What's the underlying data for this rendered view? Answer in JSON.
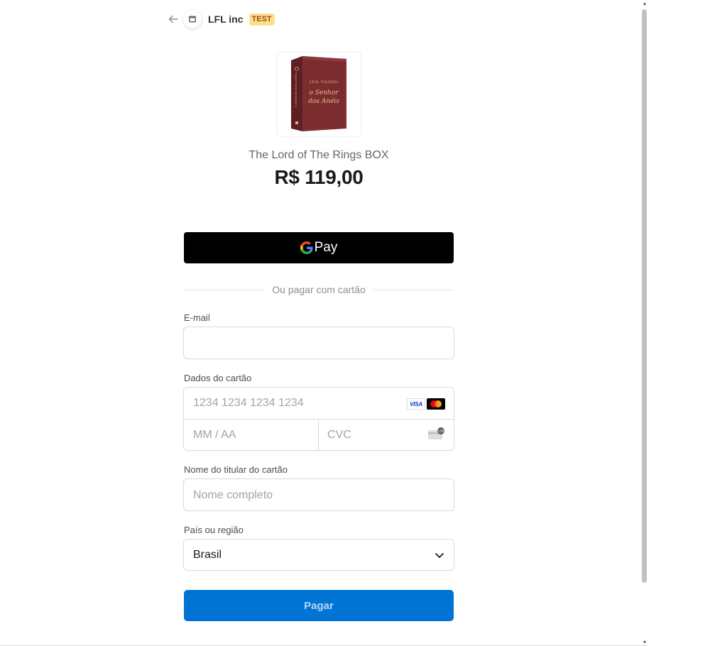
{
  "header": {
    "back_icon": "arrow-left-icon",
    "store_icon": "store-icon",
    "merchant_name": "LFL inc",
    "test_badge": "TEST"
  },
  "product": {
    "image_icon": "book-box-image",
    "name": "The Lord of The Rings BOX",
    "price": "R$ 119,00",
    "image_color": "#7a2a2e"
  },
  "gpay": {
    "label": "Pay",
    "icon": "google-g-icon"
  },
  "divider": {
    "text": "Ou pagar com cartão"
  },
  "email": {
    "label": "E-mail",
    "value": "",
    "placeholder": ""
  },
  "card": {
    "label": "Dados do cartão",
    "number_placeholder": "1234 1234 1234 1234",
    "expiry_placeholder": "MM / AA",
    "cvc_placeholder": "CVC",
    "visa_text": "VISA",
    "brands": [
      "visa-icon",
      "mastercard-icon"
    ],
    "cvc_icon": "card-cvc-icon"
  },
  "cardholder": {
    "label": "Nome do titular do cartão",
    "placeholder": "Nome completo"
  },
  "country": {
    "label": "País ou região",
    "selected": "Brasil",
    "icon": "chevron-down-icon"
  },
  "pay_button": {
    "label": "Pagar",
    "color": "#0074d4"
  },
  "colors": {
    "accent": "#0074d4",
    "test_badge_bg": "#ffde92",
    "test_badge_text": "#a04e00"
  }
}
